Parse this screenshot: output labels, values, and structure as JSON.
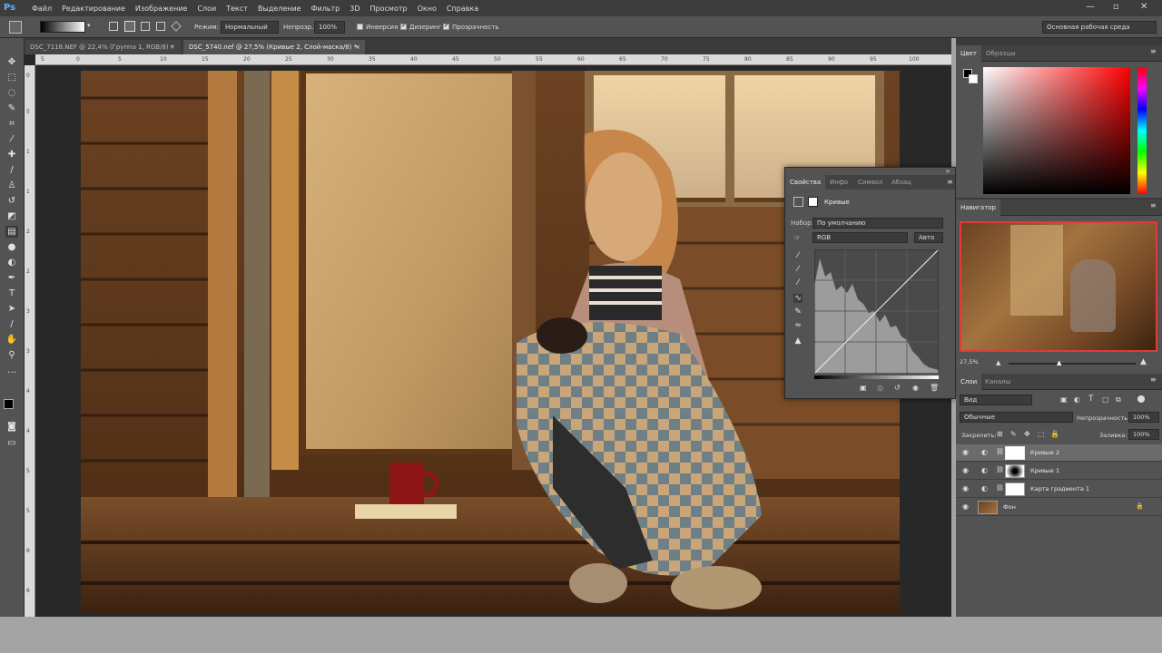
{
  "app": {
    "logo": "Ps"
  },
  "menu": [
    "Файл",
    "Редактирование",
    "Изображение",
    "Слои",
    "Текст",
    "Выделение",
    "Фильтр",
    "3D",
    "Просмотр",
    "Окно",
    "Справка"
  ],
  "window_controls": {
    "minimize": "—",
    "restore": "▫",
    "close": "✕"
  },
  "options": {
    "mode_label": "Режим:",
    "mode_value": "Нормальный",
    "opacity_label": "Непрозр.:",
    "opacity_value": "100%",
    "inverse_label": "Инверсия",
    "dither_label": "Дизеринг",
    "transparency_label": "Прозрачность",
    "workspace_value": "Основная рабочая среда"
  },
  "tabs": [
    {
      "label": "DSC_7118.NEF @ 22,4% (Группа 1, RGB/8) *",
      "close": "×"
    },
    {
      "label": "DSC_5740.nef @ 27,5% (Кривые 2, Слой-маска/8) *",
      "close": "×"
    }
  ],
  "ruler_top": [
    "5",
    "0",
    "5",
    "10",
    "15",
    "20",
    "25",
    "30",
    "35",
    "40",
    "45",
    "50",
    "55",
    "60",
    "65",
    "70",
    "75",
    "80",
    "85",
    "90",
    "95",
    "100"
  ],
  "ruler_left": [
    "0",
    "5",
    "1",
    "1",
    "2",
    "2",
    "3",
    "3",
    "4",
    "4",
    "5",
    "5",
    "6",
    "6"
  ],
  "color_panel": {
    "tabs": [
      "Цвет",
      "Образцы"
    ]
  },
  "navigator": {
    "title": "Навигатор",
    "zoom": "27,5%"
  },
  "properties": {
    "tabs": [
      "Свойства",
      "Инфо",
      "Символ",
      "Абзац"
    ],
    "type_label": "Кривые",
    "preset_label": "Набор:",
    "preset_value": "По умолчанию",
    "channel_value": "RGB",
    "auto_label": "Авто"
  },
  "layers_panel": {
    "tabs": [
      "Слои",
      "Каналы"
    ],
    "filter_value": "Вид",
    "blend_value": "Обычные",
    "opacity_label": "Непрозрачность:",
    "opacity_value": "100%",
    "lock_label": "Закрепить:",
    "fill_label": "Заливка:",
    "fill_value": "100%",
    "layers": [
      {
        "name": "Кривые 2",
        "selected": true
      },
      {
        "name": "Кривые 1",
        "selected": false
      },
      {
        "name": "Карта градиента 1",
        "selected": false
      },
      {
        "name": "Фон",
        "selected": false
      }
    ]
  },
  "colors": {
    "ps_blue": "#5ab1ff",
    "panel_bg": "#535353",
    "dark_bg": "#3b3b3b",
    "navigator_frame": "#e03a3a"
  }
}
